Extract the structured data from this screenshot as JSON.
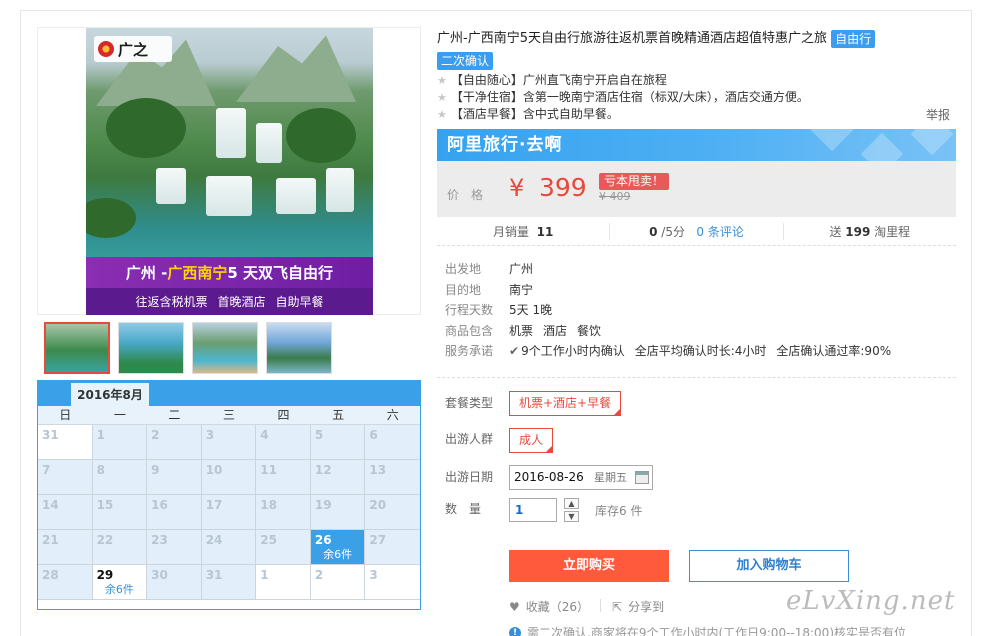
{
  "product": {
    "title": "广州-广西南宁5天自由行旅游往返机票首晚精通酒店超值特惠广之旅",
    "tag_free": "自由行",
    "tag_confirm": "二次确认",
    "features": [
      "【自由随心】广州直飞南宁开启自在旅程",
      "【干净住宿】含第一晚南宁酒店住宿（标双/大床），酒店交通方便。",
      "【酒店早餐】含中式自助早餐。"
    ],
    "report": "举报"
  },
  "image": {
    "logo_text": "广之",
    "banner_route_a": "广州 - ",
    "banner_route_b": "广西南宁",
    "banner_route_c": " 5 天双飞自由行",
    "banner_sub": [
      "往返含税机票",
      "首晚酒店",
      "自助早餐"
    ]
  },
  "brand": {
    "name": "阿里旅行·去啊"
  },
  "price": {
    "label": "价格",
    "currency": "¥",
    "value": "399",
    "promo": "亏本甩卖！",
    "old": "¥ 409"
  },
  "stats": {
    "sales_label": "月销量",
    "sales": "11",
    "rating": "0",
    "rating_suffix": "/5分",
    "reviews": "0 条评论",
    "points_prefix": "送",
    "points": "199",
    "points_suffix": "淘里程"
  },
  "meta": [
    {
      "k": "出发地",
      "v": [
        "广州"
      ]
    },
    {
      "k": "目的地",
      "v": [
        "南宁"
      ]
    },
    {
      "k": "行程天数",
      "v": [
        "5天 1晚"
      ]
    },
    {
      "k": "商品包含",
      "v": [
        "机票",
        "酒店",
        "餐饮"
      ]
    },
    {
      "k": "服务承诺",
      "v": [
        "9个工作小时内确认",
        "全店平均确认时长:4小时",
        "全店确认通过率:90%"
      ]
    }
  ],
  "options": {
    "package_label": "套餐类型",
    "package_value": "机票+酒店+早餐",
    "people_label": "出游人群",
    "people_value": "成人",
    "date_label": "出游日期",
    "date_value": "2016-08-26",
    "date_weekday": "星期五",
    "qty_label": "数　量",
    "qty_value": "1",
    "stock": "库存6 件"
  },
  "actions": {
    "buy": "立即购买",
    "cart": "加入购物车",
    "fav": "收藏（26）",
    "share": "分享到",
    "notice": "需二次确认,商家将在9个工作小时内(工作日9:00--18:00)核实是否有位"
  },
  "calendar": {
    "month": "2016年8月",
    "weekdays": [
      "日",
      "一",
      "二",
      "三",
      "四",
      "五",
      "六"
    ],
    "days": [
      {
        "d": "31",
        "s": "",
        "state": "white"
      },
      {
        "d": "1",
        "s": "",
        "state": ""
      },
      {
        "d": "2",
        "s": "",
        "state": ""
      },
      {
        "d": "3",
        "s": "",
        "state": ""
      },
      {
        "d": "4",
        "s": "",
        "state": ""
      },
      {
        "d": "5",
        "s": "",
        "state": ""
      },
      {
        "d": "6",
        "s": "",
        "state": ""
      },
      {
        "d": "7",
        "s": "",
        "state": ""
      },
      {
        "d": "8",
        "s": "",
        "state": ""
      },
      {
        "d": "9",
        "s": "",
        "state": ""
      },
      {
        "d": "10",
        "s": "",
        "state": ""
      },
      {
        "d": "11",
        "s": "",
        "state": ""
      },
      {
        "d": "12",
        "s": "",
        "state": ""
      },
      {
        "d": "13",
        "s": "",
        "state": ""
      },
      {
        "d": "14",
        "s": "",
        "state": ""
      },
      {
        "d": "15",
        "s": "",
        "state": ""
      },
      {
        "d": "16",
        "s": "",
        "state": ""
      },
      {
        "d": "17",
        "s": "",
        "state": ""
      },
      {
        "d": "18",
        "s": "",
        "state": ""
      },
      {
        "d": "19",
        "s": "",
        "state": ""
      },
      {
        "d": "20",
        "s": "",
        "state": ""
      },
      {
        "d": "21",
        "s": "",
        "state": ""
      },
      {
        "d": "22",
        "s": "",
        "state": ""
      },
      {
        "d": "23",
        "s": "",
        "state": ""
      },
      {
        "d": "24",
        "s": "",
        "state": ""
      },
      {
        "d": "25",
        "s": "",
        "state": ""
      },
      {
        "d": "26",
        "s": "余6件",
        "state": "sel"
      },
      {
        "d": "27",
        "s": "",
        "state": ""
      },
      {
        "d": "28",
        "s": "",
        "state": ""
      },
      {
        "d": "29",
        "s": "余6件",
        "state": "avail white"
      },
      {
        "d": "30",
        "s": "",
        "state": ""
      },
      {
        "d": "31",
        "s": "",
        "state": ""
      },
      {
        "d": "1",
        "s": "",
        "state": "white"
      },
      {
        "d": "2",
        "s": "",
        "state": "white"
      },
      {
        "d": "3",
        "s": "",
        "state": "white"
      }
    ]
  },
  "watermark": "eLvXing.net",
  "colors": {
    "accent": "#3aa0e8",
    "price": "#e64a3c",
    "buy": "#ff5a3c"
  }
}
